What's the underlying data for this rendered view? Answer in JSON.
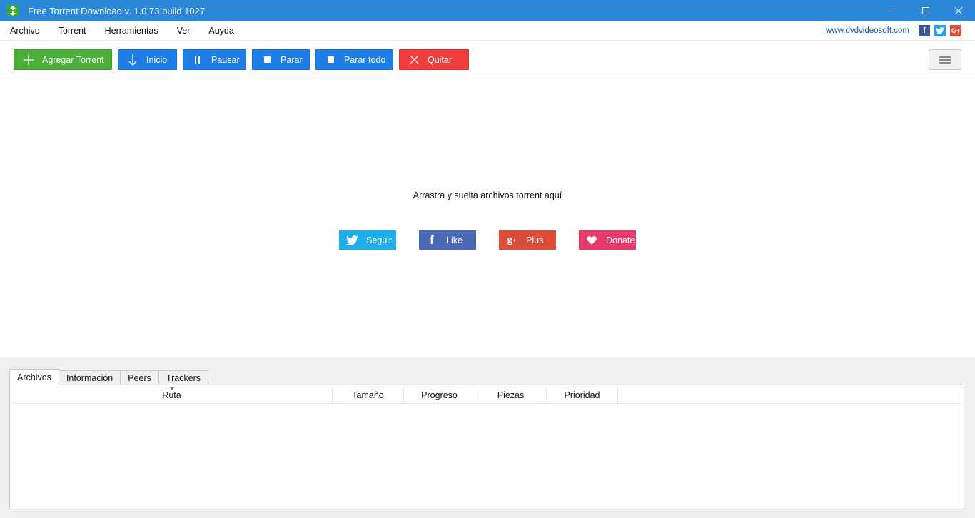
{
  "window": {
    "title": "Free Torrent Download v. 1.0.73 build 1027"
  },
  "menu": {
    "items": [
      "Archivo",
      "Torrent",
      "Herramientas",
      "Ver",
      "Auyda"
    ],
    "site_link": "www.dvdvideosoft.com"
  },
  "toolbar": {
    "add_label": "Agregar Torrent",
    "start_label": "Inicio",
    "pause_label": "Pausar",
    "stop_label": "Parar",
    "stop_all_label": "Parar todo",
    "remove_label": "Quitar"
  },
  "droparea": {
    "hint": "Arrastra y suelta archivos torrent aquí",
    "follow_label": "Seguir",
    "like_label": "Like",
    "plus_label": "Plus",
    "donate_label": "Donate"
  },
  "tabs": [
    "Archivos",
    "Información",
    "Peers",
    "Trackers"
  ],
  "table": {
    "columns": [
      "Ruta",
      "Tamaño",
      "Progreso",
      "Piezas",
      "Prioridad"
    ]
  },
  "colors": {
    "titlebar": "#2b88d8",
    "green": "#4caf3a",
    "blue": "#1e7ee6",
    "red": "#f03e3e",
    "twitter": "#1dafec",
    "facebook": "#4a6ab8",
    "gplus": "#dd4b39",
    "donate": "#e8396b"
  }
}
